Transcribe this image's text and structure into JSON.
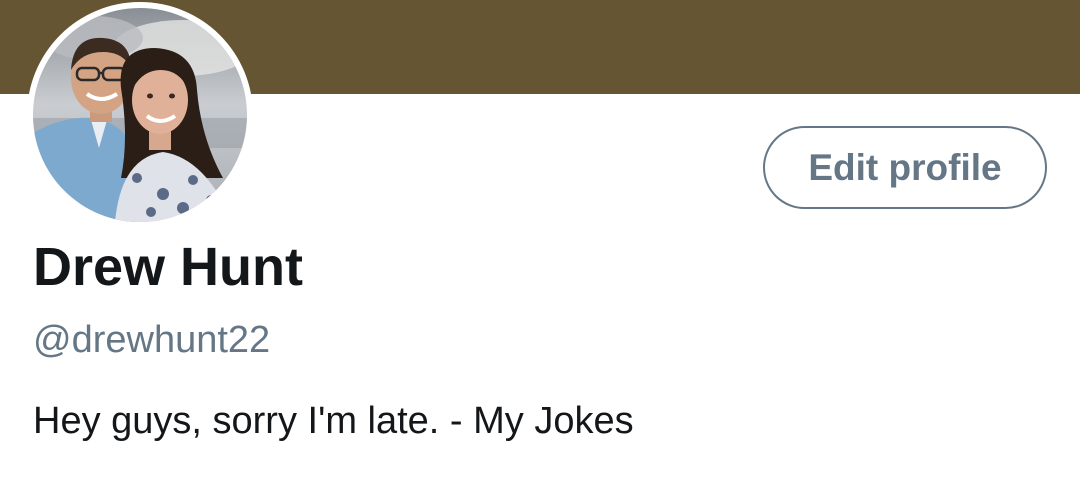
{
  "profile": {
    "banner_color": "#655532",
    "display_name": "Drew Hunt",
    "handle": "@drewhunt22",
    "bio": "Hey guys, sorry I'm late. - My Jokes",
    "edit_profile_label": "Edit profile",
    "text_primary_color": "#14171a",
    "text_secondary_color": "#657786"
  }
}
